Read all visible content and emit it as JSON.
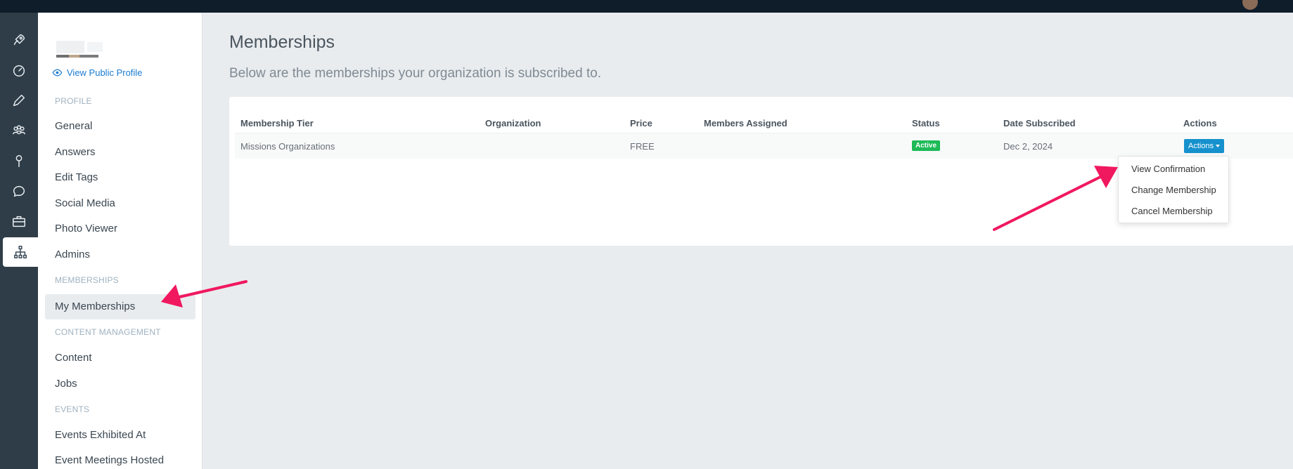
{
  "sidebar": {
    "view_public_profile": "View Public Profile",
    "sections": {
      "profile": "PROFILE",
      "memberships": "MEMBERSHIPS",
      "content_management": "CONTENT MANAGEMENT",
      "events": "EVENTS"
    },
    "items": {
      "general": "General",
      "answers": "Answers",
      "edit_tags": "Edit Tags",
      "social_media": "Social Media",
      "photo_viewer": "Photo Viewer",
      "admins": "Admins",
      "my_memberships": "My Memberships",
      "content": "Content",
      "jobs": "Jobs",
      "events_exhibited_at": "Events Exhibited At",
      "event_meetings_hosted": "Event Meetings Hosted"
    }
  },
  "rail_icons": [
    "rocket-icon",
    "dashboard-icon",
    "pencil-icon",
    "users-icon",
    "map-pin-icon",
    "chat-icon",
    "briefcase-icon",
    "sitemap-icon"
  ],
  "page": {
    "title": "Memberships",
    "subtitle": "Below are the memberships your organization is subscribed to."
  },
  "table": {
    "headers": {
      "tier": "Membership Tier",
      "organization": "Organization",
      "price": "Price",
      "members": "Members Assigned",
      "status": "Status",
      "date": "Date Subscribed",
      "actions": "Actions"
    },
    "row": {
      "tier": "Missions Organizations",
      "organization": "",
      "price": "FREE",
      "members": "",
      "status": "Active",
      "date": "Dec 2, 2024",
      "actions_label": "Actions"
    }
  },
  "dropdown": {
    "items": [
      "View Confirmation",
      "Change Membership",
      "Cancel Membership"
    ]
  },
  "colors": {
    "accent": "#1591cd",
    "status_active": "#1cba57",
    "annotation_arrow": "#f0185f",
    "rail": "#2f3d48",
    "topbar": "#0f1d2b"
  }
}
